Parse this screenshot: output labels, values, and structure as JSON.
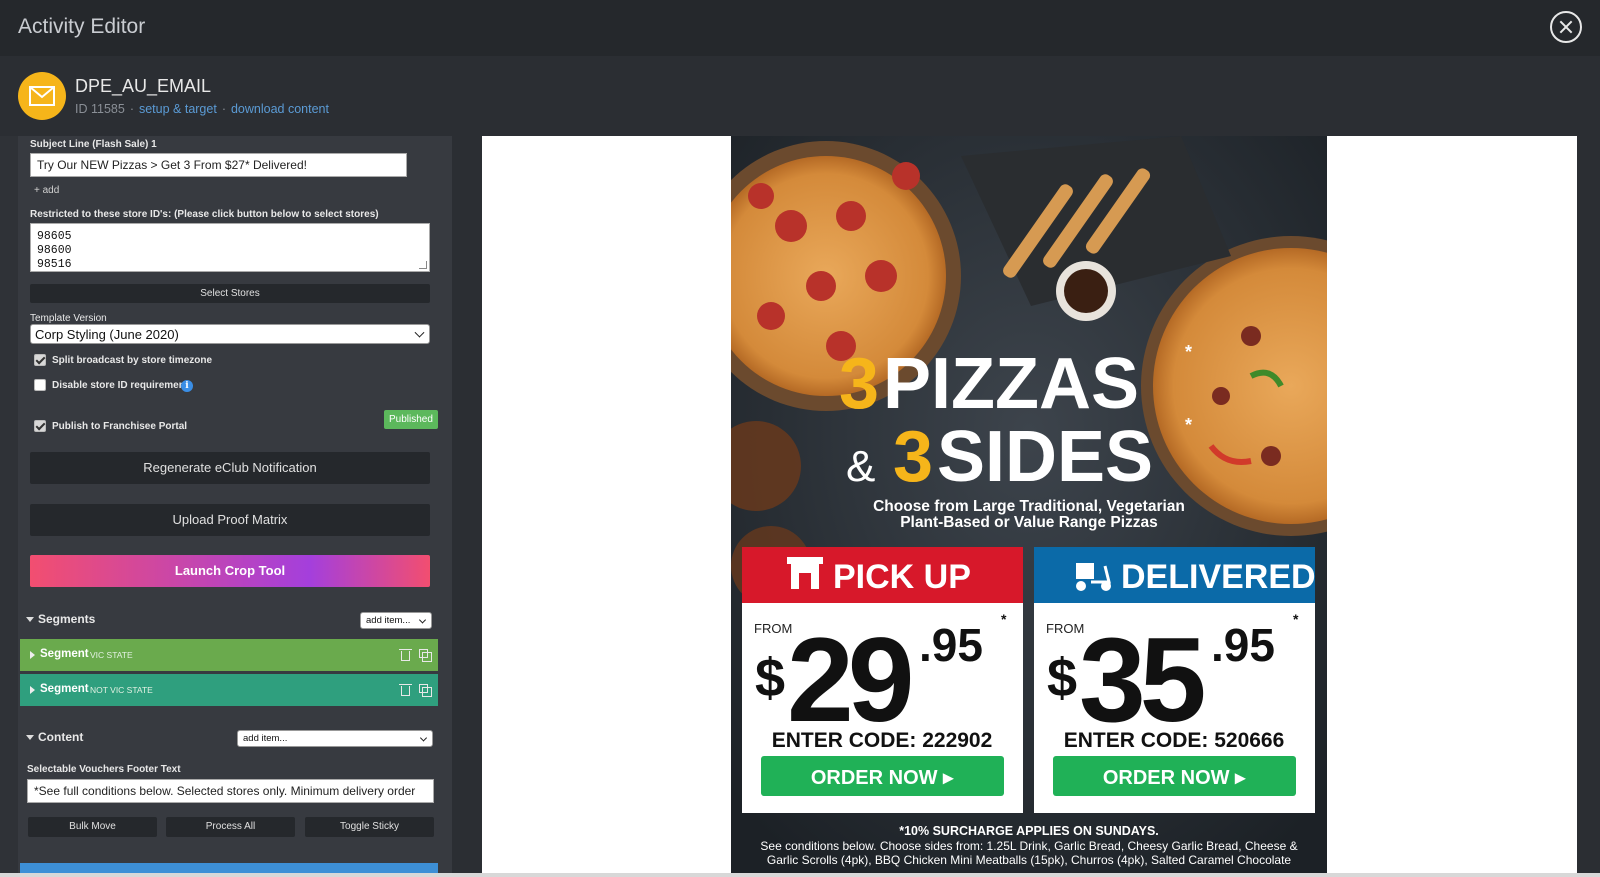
{
  "window": {
    "title": "Activity Editor"
  },
  "activity": {
    "name": "DPE_AU_EMAIL",
    "id_text": "ID 11585",
    "links": {
      "setup": "setup & target",
      "download": "download content"
    },
    "icon": "envelope-icon"
  },
  "form": {
    "subject_label": "Subject Line (Flash Sale) 1",
    "subject_value": "Try Our NEW Pizzas > Get 3 From $27* Delivered!",
    "add_link": "+ add",
    "stores_label": "Restricted to these store ID's: (Please click button below to select stores)",
    "store_ids": [
      "98605",
      "98600",
      "98516"
    ],
    "select_stores_button": "Select Stores",
    "template_label": "Template Version",
    "template_value": "Corp Styling (June 2020)",
    "split_broadcast": {
      "label": "Split broadcast by store timezone",
      "checked": true
    },
    "disable_store_id": {
      "label": "Disable store ID requirement",
      "checked": false
    },
    "publish": {
      "label": "Publish to Franchisee Portal",
      "checked": true
    },
    "published_badge": "Published",
    "regenerate_button": "Regenerate eClub Notification",
    "upload_button": "Upload Proof Matrix",
    "crop_button": "Launch Crop Tool"
  },
  "segments": {
    "heading": "Segments",
    "add_item": "add item...",
    "items": [
      {
        "label": "Segment",
        "tag": "VIC STATE",
        "color": "#6aaa4d"
      },
      {
        "label": "Segment",
        "tag": "NOT VIC STATE",
        "color": "#2f9f7e"
      }
    ]
  },
  "content": {
    "heading": "Content",
    "add_item": "add item...",
    "footer_label": "Selectable Vouchers Footer Text",
    "footer_value": "*See full conditions below. Selected stores only. Minimum delivery order",
    "buttons": [
      "Bulk Move",
      "Process All",
      "Toggle Sticky"
    ]
  },
  "email": {
    "headline_num1": "3",
    "headline_word1": "PIZZAS",
    "headline_amp": "&",
    "headline_num2": "3",
    "headline_word2": "SIDES",
    "asterisk": "*",
    "subhead_line1": "Choose from Large Traditional, Vegetarian",
    "subhead_line2": "Plant-Based or Value Range Pizzas",
    "pickup": {
      "title": "PICK UP",
      "from": "FROM",
      "dollar": "$",
      "price_main": "29",
      "price_cents": ".95",
      "code": "ENTER CODE: 222902",
      "cta": "ORDER NOW ▸",
      "color": "#d7182a"
    },
    "delivered": {
      "title": "DELIVERED",
      "from": "FROM",
      "dollar": "$",
      "price_main": "35",
      "price_cents": ".95",
      "code": "ENTER CODE: 520666",
      "cta": "ORDER NOW ▸",
      "color": "#0b6aa8"
    },
    "surcharge": "*10% SURCHARGE APPLIES ON SUNDAYS.",
    "conditions_line1": "See conditions below. Choose sides from: 1.25L Drink, Garlic Bread, Cheesy Garlic Bread, Cheese &",
    "conditions_line2": "Garlic Scrolls (4pk), BBQ Chicken Mini Meatballs (15pk), Churros (4pk), Salted Caramel Chocolate"
  },
  "colors": {
    "accent_blue": "#5b9bd5",
    "brand_yellow": "#f6b51a",
    "cta_green": "#20b157",
    "published_green": "#5cb85c"
  }
}
